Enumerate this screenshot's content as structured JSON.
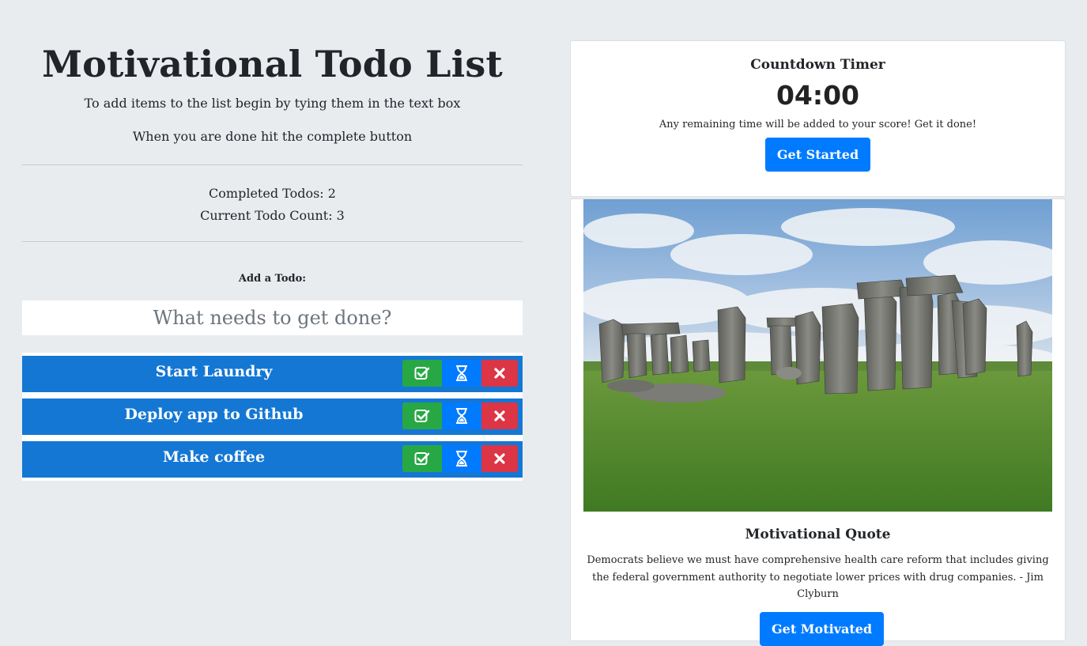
{
  "header": {
    "title": "Motivational Todo List",
    "subtitle_1": "To add items to the list begin by tying them in the text box",
    "subtitle_2": "When you are done hit the complete button"
  },
  "stats": {
    "completed": "Completed Todos: 2",
    "current": "Current Todo Count: 3"
  },
  "add_todo": {
    "label": "Add a Todo:",
    "placeholder": "What needs to get done?",
    "value": ""
  },
  "todos": [
    {
      "text": "Start Laundry"
    },
    {
      "text": "Deploy app to Github"
    },
    {
      "text": "Make coffee"
    }
  ],
  "icons": {
    "complete": "check-square-icon",
    "snooze": "hourglass-icon",
    "delete": "close-icon"
  },
  "timer": {
    "title": "Countdown Timer",
    "value": "04:00",
    "note": "Any remaining time will be added to your score! Get it done!",
    "button_label": "Get Started"
  },
  "quote": {
    "title": "Motivational Quote",
    "text": "Democrats believe we must have comprehensive health care reform that includes giving the federal government authority to negotiate lower prices with drug companies. - Jim Clyburn",
    "button_label": "Get Motivated"
  },
  "colors": {
    "background": "#e8ecef",
    "todo_item": "#1477d4",
    "complete": "#28a745",
    "snooze": "#007bff",
    "delete": "#dc3545",
    "primary_button": "#007bff"
  }
}
